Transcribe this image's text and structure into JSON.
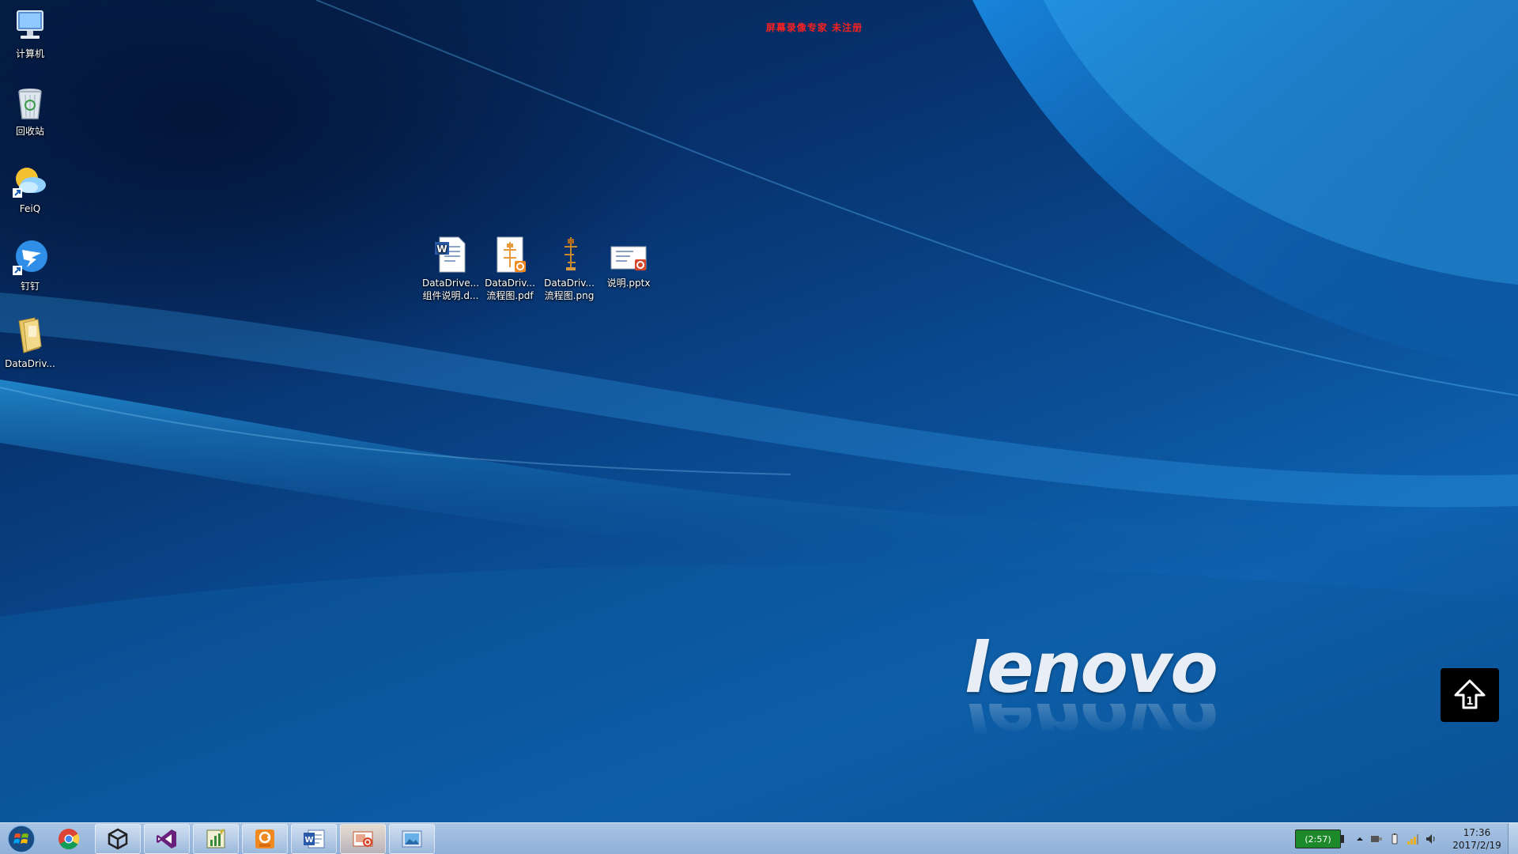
{
  "banner": "屏幕录像专家 未注册",
  "desktop_icons_left": [
    {
      "name": "computer-icon",
      "label": "计算机"
    },
    {
      "name": "recycle-bin-icon",
      "label": "回收站"
    },
    {
      "name": "feiq-icon",
      "label": "FeiQ"
    },
    {
      "name": "dingtalk-icon",
      "label": "钉钉"
    },
    {
      "name": "folder-icon",
      "label": "DataDriv..."
    }
  ],
  "desktop_icons_files": [
    {
      "name": "word-document-icon",
      "label": "DataDrive...\n组件说明.d..."
    },
    {
      "name": "pdf-document-icon",
      "label": "DataDriv...\n流程图.pdf"
    },
    {
      "name": "png-image-icon",
      "label": "DataDriv...\n流程图.png"
    },
    {
      "name": "powerpoint-icon",
      "label": "说明.pptx"
    }
  ],
  "logo_text": "lenovo",
  "taskbar": {
    "items": [
      "start-orb-icon",
      "chrome-icon",
      "unity-icon",
      "visual-studio-icon",
      "charts-app-icon",
      "pdf-reader-icon",
      "word-icon",
      "powerpoint-icon",
      "photo-viewer-icon"
    ],
    "battery_text": "(2:57)",
    "time": "17:36",
    "date": "2017/2/19"
  },
  "colors": {
    "banner": "#ff2020",
    "taskbar": "#a9c4e4",
    "battery": "#1c8a2a"
  }
}
